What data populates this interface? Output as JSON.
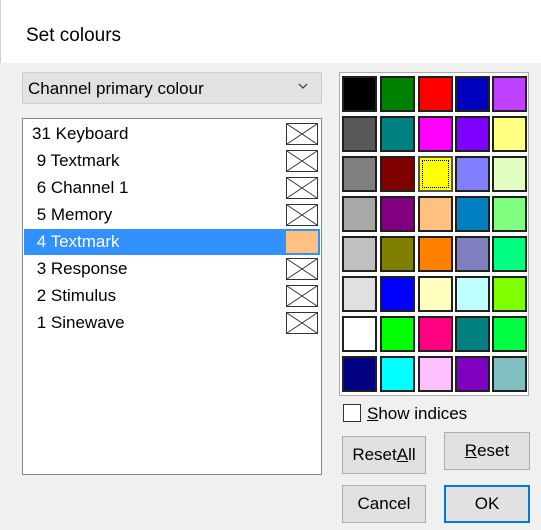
{
  "dialog": {
    "title": "Set colours"
  },
  "dropdown": {
    "selected": "Channel primary colour"
  },
  "channels": [
    {
      "label": "31 Keyboard",
      "selected": false,
      "swatch": "none"
    },
    {
      "label": " 9 Textmark",
      "selected": false,
      "swatch": "none"
    },
    {
      "label": " 6 Channel 1",
      "selected": false,
      "swatch": "none"
    },
    {
      "label": " 5 Memory",
      "selected": false,
      "swatch": "none"
    },
    {
      "label": " 4 Textmark",
      "selected": true,
      "swatch": "#ffc080"
    },
    {
      "label": " 3 Response",
      "selected": false,
      "swatch": "none"
    },
    {
      "label": " 2 Stimulus",
      "selected": false,
      "swatch": "none"
    },
    {
      "label": " 1 Sinewave",
      "selected": false,
      "swatch": "none"
    }
  ],
  "palette": {
    "selected_index": 12,
    "colors": [
      "#000000",
      "#008000",
      "#ff0000",
      "#0000c0",
      "#c040ff",
      "#585858",
      "#008080",
      "#ff00ff",
      "#8000ff",
      "#ffff80",
      "#808080",
      "#800000",
      "#ffff00",
      "#8080ff",
      "#e0ffc0",
      "#a8a8a8",
      "#800080",
      "#ffc080",
      "#0080c0",
      "#80ff80",
      "#c0c0c0",
      "#808000",
      "#ff8000",
      "#8080c0",
      "#00ff80",
      "#e0e0e0",
      "#0000ff",
      "#ffffc0",
      "#c0ffff",
      "#80ff00",
      "#ffffff",
      "#00ff00",
      "#ff0080",
      "#008080",
      "#00ff40",
      "#000080",
      "#00ffff",
      "#ffc0ff",
      "#8000c0",
      "#80c0c0"
    ]
  },
  "options": {
    "show_indices_pre": "",
    "show_indices_ul": "S",
    "show_indices_post": "how indices",
    "show_indices_checked": false
  },
  "buttons": {
    "reset_all_pre": "Reset ",
    "reset_all_ul": "A",
    "reset_all_post": "ll",
    "reset_ul": "R",
    "reset_post": "eset",
    "cancel": "Cancel",
    "ok": "OK"
  }
}
